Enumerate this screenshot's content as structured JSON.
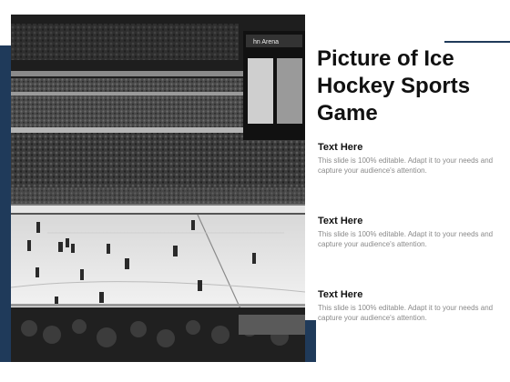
{
  "title": "Picture of Ice Hockey Sports Game",
  "sections": [
    {
      "heading": "Text Here",
      "body": "This slide is 100% editable. Adapt it to your needs and capture your audience's attention."
    },
    {
      "heading": "Text Here",
      "body": "This slide is 100% editable. Adapt it to your needs and capture your audience's attention."
    },
    {
      "heading": "Text Here",
      "body": "This slide is 100% editable. Adapt it to your needs and capture your audience's attention."
    }
  ],
  "photo": {
    "arena_sign": "hn Arena",
    "description_icon": "hockey-arena-photo"
  },
  "colors": {
    "accent": "#1f3a5a",
    "title": "#111111",
    "body_text": "#8a8a8a"
  }
}
